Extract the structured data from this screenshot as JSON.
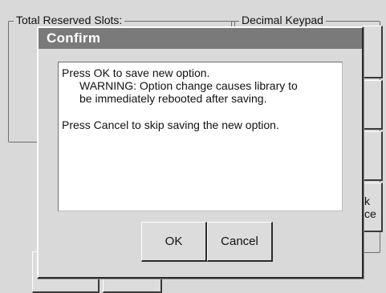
{
  "background": {
    "groups": [
      {
        "legend": "Total Reserved Slots:"
      },
      {
        "legend": "Decimal Keypad"
      }
    ],
    "partial_button_text": [
      "k",
      "ce"
    ]
  },
  "dialog": {
    "title": "Confirm",
    "message": {
      "line1": "Press OK to save new option.",
      "line2": "WARNING: Option change causes library to",
      "line3": "be immediately rebooted after saving.",
      "line4": "Press Cancel to skip saving the new option."
    },
    "buttons": {
      "ok_label": "OK",
      "cancel_label": "Cancel"
    }
  },
  "colors": {
    "titlebar": "#7a7a7a",
    "window_bg": "#d9d9d9",
    "message_bg": "#ffffff"
  }
}
